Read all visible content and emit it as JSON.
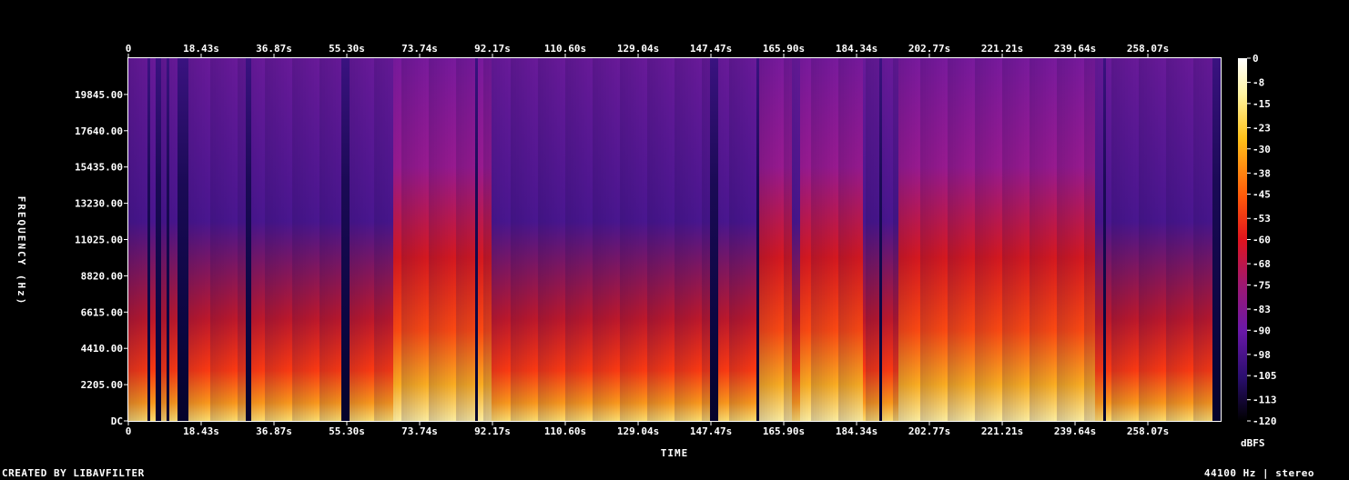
{
  "footer": {
    "left": "CREATED BY LIBAVFILTER",
    "right": "44100 Hz | stereo"
  },
  "chart_data": {
    "type": "heatmap",
    "xlabel": "TIME",
    "ylabel": "FREQUENCY (Hz)",
    "colorbar_label": "dBFS",
    "x_ticks": [
      "0",
      "18.43s",
      "36.87s",
      "55.30s",
      "73.74s",
      "92.17s",
      "110.60s",
      "129.04s",
      "147.47s",
      "165.90s",
      "184.34s",
      "202.77s",
      "221.21s",
      "239.64s",
      "258.07s"
    ],
    "x_tick_values": [
      0,
      18.43,
      36.87,
      55.3,
      73.74,
      92.17,
      110.6,
      129.04,
      147.47,
      165.9,
      184.34,
      202.77,
      221.21,
      239.64,
      258.07
    ],
    "xlim": [
      0,
      276.5
    ],
    "y_ticks": [
      "DC",
      "2205.00",
      "4410.00",
      "6615.00",
      "8820.00",
      "11025.00",
      "13230.00",
      "15435.00",
      "17640.00",
      "19845.00"
    ],
    "y_tick_values": [
      0,
      2205,
      4410,
      6615,
      8820,
      11025,
      13230,
      15435,
      17640,
      19845
    ],
    "ylim": [
      0,
      22050
    ],
    "colorbar_ticks": [
      "0",
      "-8",
      "-15",
      "-23",
      "-30",
      "-38",
      "-45",
      "-53",
      "-60",
      "-68",
      "-75",
      "-83",
      "-90",
      "-98",
      "-105",
      "-113",
      "-120"
    ],
    "colorbar_values": [
      0,
      -8,
      -15,
      -23,
      -30,
      -38,
      -45,
      -53,
      -60,
      -68,
      -75,
      -83,
      -90,
      -98,
      -105,
      -113,
      -120
    ],
    "colorbar_range": [
      -120,
      0
    ],
    "quiet_segments_s": [
      [
        4.5,
        5.5
      ],
      [
        6.8,
        8.3
      ],
      [
        9.6,
        10.6
      ],
      [
        12.2,
        15.3
      ],
      [
        30.0,
        31.0
      ],
      [
        53.6,
        56.3
      ],
      [
        87.5,
        88.2
      ],
      [
        147.5,
        149.0
      ],
      [
        159.3,
        159.9
      ],
      [
        190.0,
        191.0
      ],
      [
        246.8,
        247.4
      ],
      [
        274.5,
        276.5
      ]
    ],
    "loud_segments_s": [
      [
        170.0,
        186.0
      ],
      [
        67.0,
        92.0
      ],
      [
        160.0,
        168.0
      ],
      [
        195.0,
        245.0
      ]
    ]
  }
}
